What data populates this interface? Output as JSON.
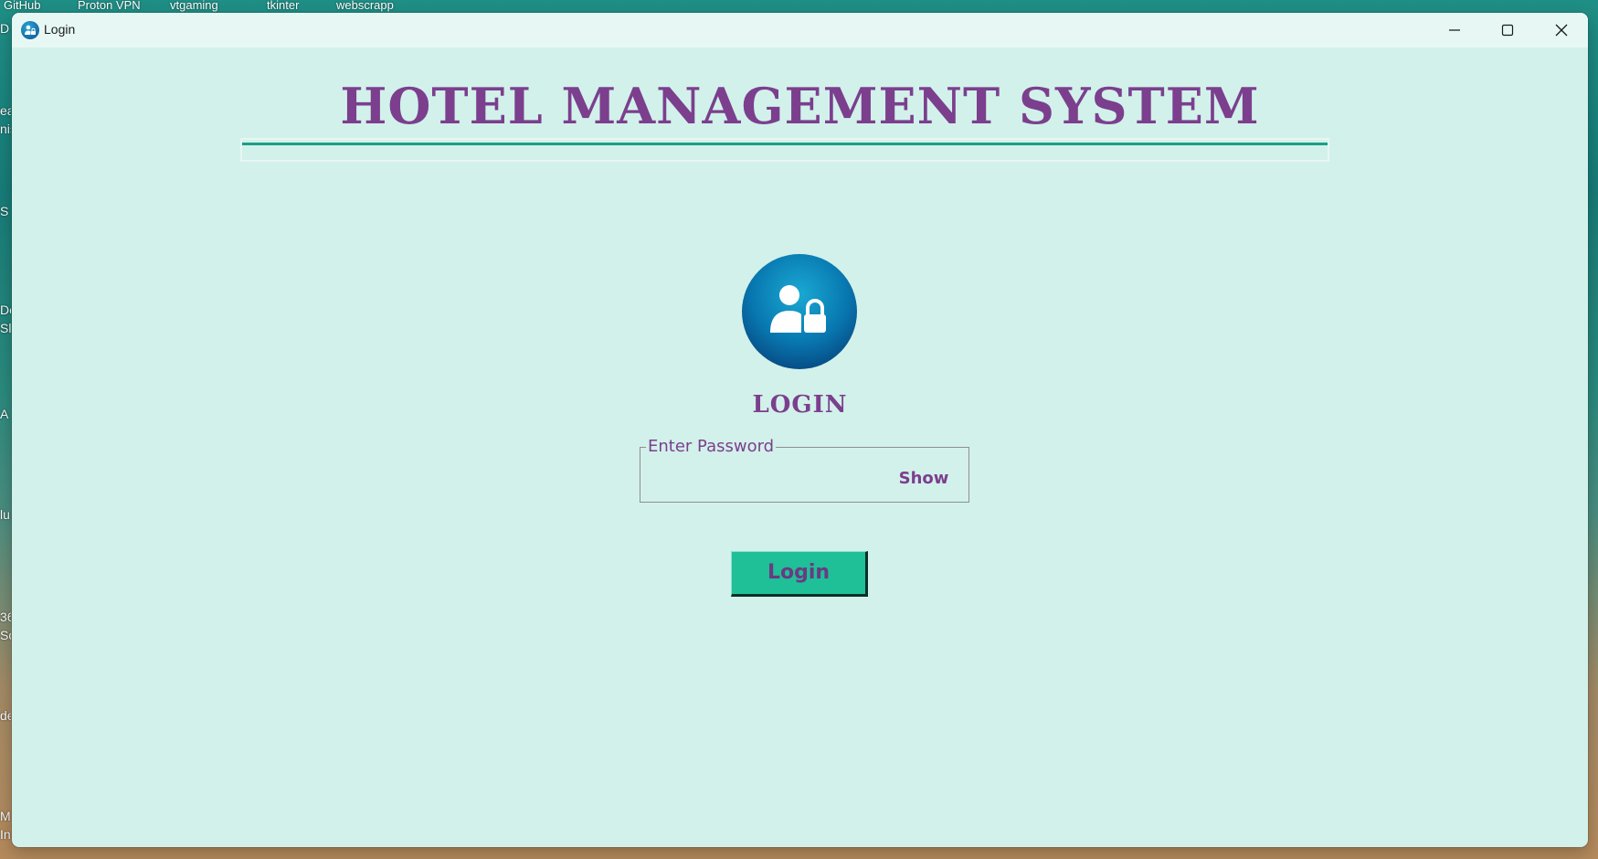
{
  "desktop": {
    "top_labels": [
      "GitHub",
      "Proton VPN",
      "vtgaming",
      "tkinter",
      "webscrapp"
    ],
    "left_labels": [
      "D",
      "ea",
      "nis",
      "S",
      "De",
      "Sl",
      "A",
      "lu",
      "36",
      "Sc",
      "de",
      "M",
      "In"
    ]
  },
  "window": {
    "title": "Login",
    "icon": "user-lock-icon",
    "controls": {
      "minimize": "minimize-icon",
      "maximize": "maximize-icon",
      "close": "close-icon"
    }
  },
  "app": {
    "title": "HOTEL MANAGEMENT SYSTEM",
    "avatar_icon": "user-lock-icon",
    "login_heading": "LOGIN",
    "password": {
      "legend": "Enter Password",
      "value": "",
      "toggle_label": "Show"
    },
    "login_button": "Login"
  },
  "colors": {
    "background": "#d2f1ea",
    "titlebar": "#e7f8f4",
    "purple_text": "#7b3f8e",
    "accent_green": "#1fbf98",
    "rule_green": "#1c9e86"
  }
}
